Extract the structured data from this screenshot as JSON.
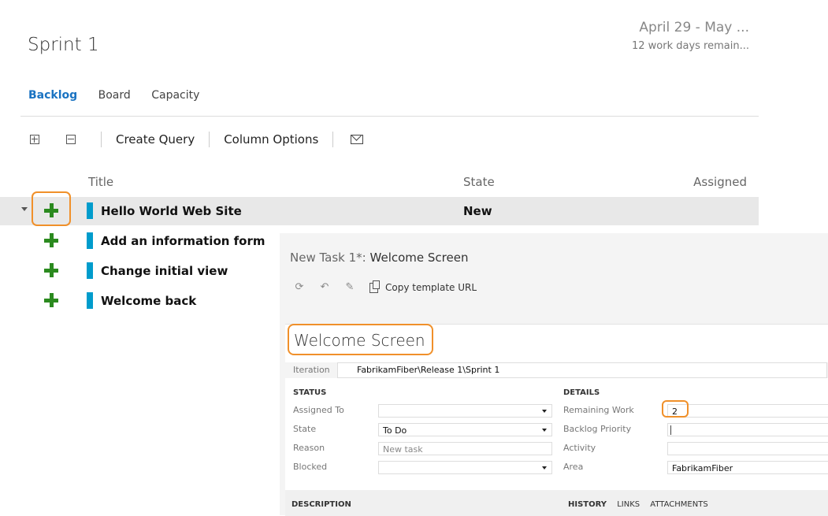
{
  "backlog": {
    "sprint_title": "Sprint 1",
    "date_range": "April 29 - May ...",
    "days_remaining": "12 work days remain...",
    "tabs": [
      "Backlog",
      "Board",
      "Capacity"
    ],
    "active_tab": "Backlog",
    "toolbar": {
      "expand_icon": "expand-all-icon",
      "collapse_icon": "collapse-all-icon",
      "create_query": "Create Query",
      "column_options": "Column Options",
      "email_icon": "email-icon"
    },
    "columns": {
      "title": "Title",
      "state": "State",
      "assigned": "Assigned"
    },
    "rows": [
      {
        "title": "Hello World Web Site",
        "state": "New"
      },
      {
        "title": "Add an information form",
        "state": ""
      },
      {
        "title": "Change initial view",
        "state": ""
      },
      {
        "title": "Welcome back",
        "state": ""
      }
    ],
    "colors": {
      "tab_active": "#1a73c2",
      "plus": "#2b8a1f",
      "work_item_bar": "#009ccc",
      "highlight": "#f0902a"
    }
  },
  "dialog": {
    "title_prefix": "New Task 1*:",
    "title_name": "Welcome Screen",
    "tools": {
      "refresh_icon": "refresh-icon",
      "undo_icon": "undo-icon",
      "clear_icon": "clear-icon",
      "copy_icon": "copy-icon",
      "copy_template": "Copy template URL"
    },
    "form_title": "Welcome Screen",
    "iteration_label": "Iteration",
    "iteration_value": "FabrikamFiber\\Release 1\\Sprint 1",
    "status": {
      "header": "STATUS",
      "assigned_to_label": "Assigned To",
      "assigned_to_value": "",
      "state_label": "State",
      "state_value": "To Do",
      "reason_label": "Reason",
      "reason_value": "New task",
      "blocked_label": "Blocked",
      "blocked_value": ""
    },
    "details": {
      "header": "DETAILS",
      "remaining_work_label": "Remaining Work",
      "remaining_work_value": "2",
      "backlog_priority_label": "Backlog Priority",
      "backlog_priority_value": "",
      "activity_label": "Activity",
      "activity_value": "",
      "area_label": "Area",
      "area_value": "FabrikamFiber"
    },
    "description_header": "DESCRIPTION",
    "bottom_tabs": [
      "HISTORY",
      "LINKS",
      "ATTACHMENTS"
    ]
  }
}
